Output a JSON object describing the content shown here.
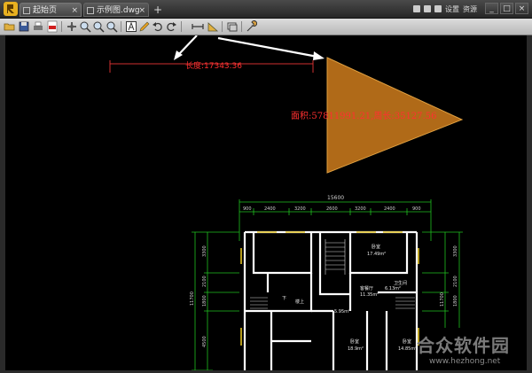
{
  "tabs": [
    {
      "label": "起始页"
    },
    {
      "label": "示例图.dwg"
    }
  ],
  "tab_add": "+",
  "top_right": {
    "settings": "设置",
    "resources": "资源"
  },
  "window_buttons": {
    "minimize": "_",
    "maximize": "□",
    "close": "×"
  },
  "drawing": {
    "length_label": "长度:17343.36",
    "area_label": "面积:57811991.21,周长:35127.56",
    "total_width": "15600",
    "top_dims": [
      "900",
      "2400",
      "3200",
      "2600",
      "3200",
      "2400",
      "900"
    ],
    "left_dims": [
      "3300",
      "2100",
      "1800",
      "4500"
    ],
    "left_total": "11700",
    "right_dims": [
      "3300",
      "2100",
      "1800"
    ],
    "right_total": "11700",
    "rooms": {
      "bedroom_top": "卧室",
      "bedroom_top_area": "17.49m²",
      "living": "客餐厅",
      "living_area": "11.35m²",
      "bathroom": "卫生间",
      "bath_area": "6.13m²",
      "stair_up": "楼上",
      "down": "下",
      "hall_area": "5.95m²",
      "bedroom_mid": "卧室",
      "bedroom_mid_area": "18.9m²",
      "bedroom_right": "卧室",
      "bedroom_right_area": "14.85m²"
    }
  },
  "watermark": {
    "main": "合众软件园",
    "sub": "www.hezhong.net"
  },
  "colors": {
    "triangle": "#b06a18",
    "dimension": "#d03030",
    "measure_text": "#ff3030",
    "wall": "#ffffff",
    "dim_line": "#20c020",
    "window": "#e0c020"
  }
}
